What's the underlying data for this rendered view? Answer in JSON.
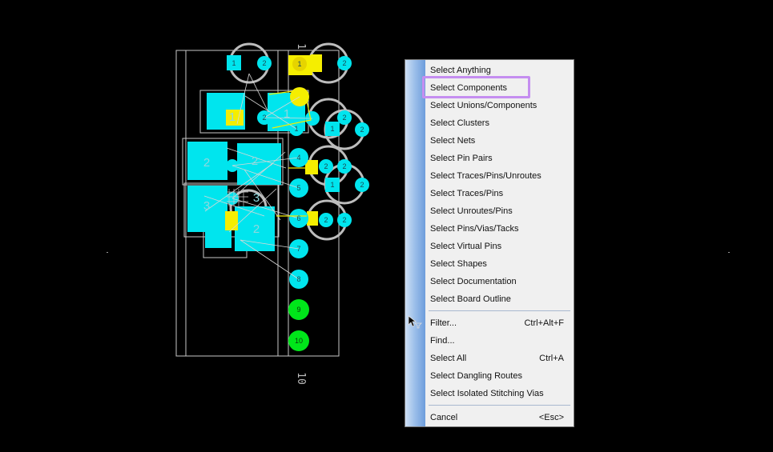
{
  "canvas": {
    "background": "#000000",
    "colors": {
      "pad": "#00e5ee",
      "yellow": "#f5ee00",
      "green": "#00e61a",
      "outline": "#c8c8c8",
      "ratsnest": "#d8d8d8"
    },
    "top_pads": [
      "1",
      "2",
      "1",
      "2",
      "2",
      "1",
      "1",
      "2",
      "2",
      "1",
      "2",
      "2",
      "2",
      "2",
      "2"
    ],
    "pin_pads": [
      "4",
      "5",
      "6",
      "7",
      "8"
    ],
    "green_pads": [
      "9",
      "10"
    ],
    "comp_labels": [
      "2",
      "2",
      "3",
      "2",
      "3",
      "1",
      "1"
    ],
    "ref_text": "10",
    "ref_text_top": "1"
  },
  "menu": {
    "group1": [
      "Select Anything",
      "Select Components",
      "Select Unions/Components",
      "Select Clusters",
      "Select Nets",
      "Select Pin Pairs",
      "Select Traces/Pins/Unroutes",
      "Select Traces/Pins",
      "Select Unroutes/Pins",
      "Select Pins/Vias/Tacks",
      "Select Virtual Pins",
      "Select Shapes",
      "Select Documentation",
      "Select Board Outline"
    ],
    "group2": [
      {
        "label": "Filter...",
        "shortcut": "Ctrl+Alt+F"
      },
      {
        "label": "Find...",
        "shortcut": ""
      },
      {
        "label": "Select All",
        "shortcut": "Ctrl+A"
      },
      {
        "label": "Select Dangling Routes",
        "shortcut": ""
      },
      {
        "label": "Select Isolated Stitching Vias",
        "shortcut": ""
      }
    ],
    "group3": [
      {
        "label": "Cancel",
        "shortcut": "<Esc>"
      }
    ],
    "highlighted": "Select Components",
    "highlight_color": "#c58ef0",
    "gutter_color": "#6d9ddc"
  }
}
